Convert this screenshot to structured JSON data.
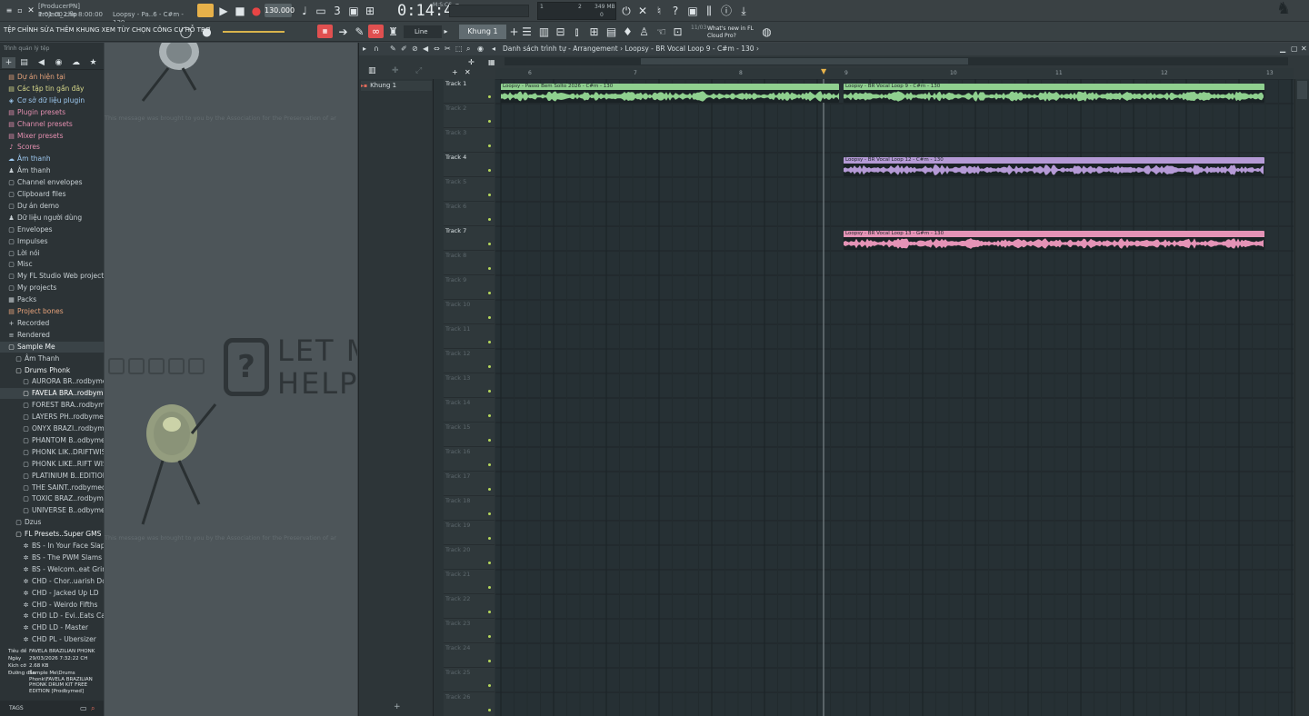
{
  "topbar": {
    "project_file": "[ProducerPN] Project_2.flp",
    "time_range": "1:01:00 cho 8:00:00",
    "hint": "Loopsy - Pa..6 - C#m - 130",
    "tempo": "130.000",
    "time": "0:14:42",
    "time_unit": "M:S:CS",
    "cpu_top": "1",
    "cpu_val": "2",
    "ram": "349 MB",
    "ram_bottom": "0",
    "pattern": "Khung 1",
    "snap": "Line",
    "news_date": "11/03",
    "news_text": "What's new in FL Cloud Pro?"
  },
  "menubar": {
    "label": "TỆP CHỈNH SỬA THÊM KHUNG XEM TÙY CHỌN CÔNG CỤ HỖ TRỢ"
  },
  "browser": {
    "header": "Trình quản lý tệp",
    "items": [
      {
        "label": "Dự án hiện tại",
        "icon": "▤",
        "color": "#e6a27a"
      },
      {
        "label": "Các tập tin gần đây",
        "icon": "▤",
        "color": "#d8d98a"
      },
      {
        "label": "Cơ sở dữ liệu plugin",
        "icon": "◈",
        "color": "#9ec9f0"
      },
      {
        "label": "Plugin presets",
        "icon": "▤",
        "color": "#e48fb0"
      },
      {
        "label": "Channel presets",
        "icon": "▤",
        "color": "#e48fb0"
      },
      {
        "label": "Mixer presets",
        "icon": "▤",
        "color": "#e48fb0"
      },
      {
        "label": "Scores",
        "icon": "♪",
        "color": "#e48fb0"
      },
      {
        "label": "Âm thanh",
        "icon": "☁",
        "color": "#9ec9f0"
      },
      {
        "label": "Âm thanh",
        "icon": "♟",
        "color": "#c8d0d4"
      },
      {
        "label": "Channel envelopes",
        "icon": "▢",
        "color": "#c8d0d4"
      },
      {
        "label": "Clipboard files",
        "icon": "▢",
        "color": "#c8d0d4"
      },
      {
        "label": "Dự án demo",
        "icon": "▢",
        "color": "#c8d0d4"
      },
      {
        "label": "Dữ liệu người dùng",
        "icon": "♟",
        "color": "#c8d0d4"
      },
      {
        "label": "Envelopes",
        "icon": "▢",
        "color": "#c8d0d4"
      },
      {
        "label": "Impulses",
        "icon": "▢",
        "color": "#c8d0d4"
      },
      {
        "label": "Lời nói",
        "icon": "▢",
        "color": "#c8d0d4"
      },
      {
        "label": "Misc",
        "icon": "▢",
        "color": "#c8d0d4"
      },
      {
        "label": "My FL Studio Web projects",
        "icon": "▢",
        "color": "#c8d0d4"
      },
      {
        "label": "My projects",
        "icon": "▢",
        "color": "#c8d0d4"
      },
      {
        "label": "Packs",
        "icon": "▦",
        "color": "#c8d0d4"
      },
      {
        "label": "Project bones",
        "icon": "▤",
        "color": "#e6a27a"
      },
      {
        "label": "Recorded",
        "icon": "+",
        "color": "#c8d0d4"
      },
      {
        "label": "Rendered",
        "icon": "≡",
        "color": "#c8d0d4"
      },
      {
        "label": "Sample Me",
        "icon": "▢",
        "color": "#eef2f3"
      },
      {
        "label": "Âm Thanh",
        "icon": "▢",
        "color": "#c8d0d4"
      },
      {
        "label": "Drums Phonk",
        "icon": "▢",
        "color": "#eef2f3"
      },
      {
        "label": "AURORA BR..rodbymed]",
        "icon": "▢",
        "color": "#c8d0d4"
      },
      {
        "label": "FAVELA BRA..rodbymed]",
        "icon": "▢",
        "color": "#ffffff"
      },
      {
        "label": "FOREST BRA..rodbymed]",
        "icon": "▢",
        "color": "#c8d0d4"
      },
      {
        "label": "LAYERS PH..rodbymed]",
        "icon": "▢",
        "color": "#c8d0d4"
      },
      {
        "label": "ONYX BRAZI..rodbymed]",
        "icon": "▢",
        "color": "#c8d0d4"
      },
      {
        "label": "PHANTOM B..odbymed]",
        "icon": "▢",
        "color": "#c8d0d4"
      },
      {
        "label": "PHONK LIK..DRIFTWISH",
        "icon": "▢",
        "color": "#c8d0d4"
      },
      {
        "label": "PHONK LIKE..RIFT WISH",
        "icon": "▢",
        "color": "#c8d0d4"
      },
      {
        "label": "PLATINIUM B..EDITION",
        "icon": "▢",
        "color": "#c8d0d4"
      },
      {
        "label": "THE SAINT..rodbymed]",
        "icon": "▢",
        "color": "#c8d0d4"
      },
      {
        "label": "TOXIC BRAZ..rodbymed]",
        "icon": "▢",
        "color": "#c8d0d4"
      },
      {
        "label": "UNIVERSE B..odbymed]",
        "icon": "▢",
        "color": "#c8d0d4"
      },
      {
        "label": "Dzus",
        "icon": "▢",
        "color": "#c8d0d4"
      },
      {
        "label": "FL Presets..Super GMS",
        "icon": "▢",
        "color": "#eef2f3"
      },
      {
        "label": "BS - In Your Face Slap",
        "icon": "✲",
        "color": "#c8d0d4"
      },
      {
        "label": "BS - The PWM Slams",
        "icon": "✲",
        "color": "#c8d0d4"
      },
      {
        "label": "BS - Welcom..eat Grinder",
        "icon": "✲",
        "color": "#c8d0d4"
      },
      {
        "label": "CHD - Chor..uarish Doom",
        "icon": "✲",
        "color": "#c8d0d4"
      },
      {
        "label": "CHD - Jacked Up LD",
        "icon": "✲",
        "color": "#c8d0d4"
      },
      {
        "label": "CHD - Weirdo Fifths",
        "icon": "✲",
        "color": "#c8d0d4"
      },
      {
        "label": "CHD LD - Evi..Eats Carrot",
        "icon": "✲",
        "color": "#c8d0d4"
      },
      {
        "label": "CHD LD - Master",
        "icon": "✲",
        "color": "#c8d0d4"
      },
      {
        "label": "CHD PL - Ubersizer",
        "icon": "✲",
        "color": "#c8d0d4"
      }
    ],
    "info": {
      "title_label": "Tiêu đề",
      "title_value": "FAVELA BRAZILIAN PHONK",
      "date_label": "Ngày",
      "date_value": "29/03/2026 7:32:22 CH",
      "size_label": "Kích cỡ",
      "size_value": "2.68 KB",
      "path_label": "Đường dẫn",
      "path_value": "Sample Me\\Drums Phonk\\FAVELA BRAZILIAN PHONK DRUM KIT FREE EDITION [Prodbymed]"
    },
    "tags": "TAGS"
  },
  "midarea": {
    "message": "This message was brought to you by the Association for the Preservation of ar",
    "help_line1": "LET M",
    "help_line2": "HELP"
  },
  "playlist": {
    "breadcrumb": "Danh sách trình tự - Arrangement › Loopsy - BR Vocal Loop 9 - C#m - 130 ›",
    "pattern_item": "Khung 1",
    "ruler": [
      "6",
      "7",
      "8",
      "9",
      "10",
      "11",
      "12",
      "13"
    ],
    "tracks": [
      "Track 1",
      "Track 2",
      "Track 3",
      "Track 4",
      "Track 5",
      "Track 6",
      "Track 7",
      "Track 8",
      "Track 9",
      "Track 10",
      "Track 11",
      "Track 12",
      "Track 13",
      "Track 14",
      "Track 15",
      "Track 16",
      "Track 17",
      "Track 18",
      "Track 19",
      "Track 20",
      "Track 21",
      "Track 22",
      "Track 23",
      "Track 24",
      "Track 25",
      "Track 26"
    ],
    "clips": [
      {
        "label": "Loopsy - Passo Bem Solto 2026 - C#m - 130",
        "track": 1,
        "color": "#8fd08f"
      },
      {
        "label": "Loopsy - BR Vocal Loop 9 - C#m - 130",
        "track": 1,
        "color": "#8fd08f"
      },
      {
        "label": "Loopsy - BR Vocal Loop 12 - C#m - 130",
        "track": 4,
        "color": "#b59ad6"
      },
      {
        "label": "Loopsy - BR Vocal Loop 13 - G#m - 130",
        "track": 7,
        "color": "#e493b6"
      }
    ]
  }
}
